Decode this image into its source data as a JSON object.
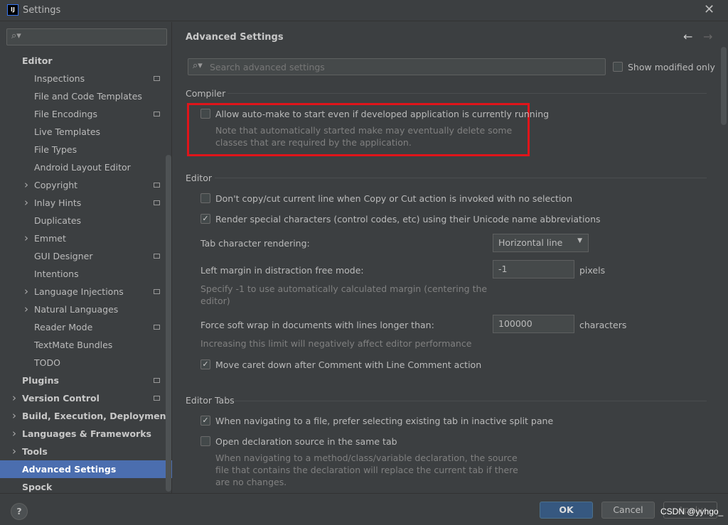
{
  "window": {
    "title": "Settings",
    "app_icon": "IJ"
  },
  "sidebar": {
    "search_placeholder": "",
    "items": [
      {
        "label": "Editor",
        "level": 0,
        "bold": true
      },
      {
        "label": "Inspections",
        "level": 1,
        "badge": true
      },
      {
        "label": "File and Code Templates",
        "level": 1
      },
      {
        "label": "File Encodings",
        "level": 1,
        "badge": true
      },
      {
        "label": "Live Templates",
        "level": 1
      },
      {
        "label": "File Types",
        "level": 1
      },
      {
        "label": "Android Layout Editor",
        "level": 1
      },
      {
        "label": "Copyright",
        "level": 1,
        "expandable": true,
        "badge": true
      },
      {
        "label": "Inlay Hints",
        "level": 1,
        "expandable": true,
        "badge": true
      },
      {
        "label": "Duplicates",
        "level": 1
      },
      {
        "label": "Emmet",
        "level": 1,
        "expandable": true
      },
      {
        "label": "GUI Designer",
        "level": 1,
        "badge": true
      },
      {
        "label": "Intentions",
        "level": 1
      },
      {
        "label": "Language Injections",
        "level": 1,
        "expandable": true,
        "badge": true
      },
      {
        "label": "Natural Languages",
        "level": 1,
        "expandable": true
      },
      {
        "label": "Reader Mode",
        "level": 1,
        "badge": true
      },
      {
        "label": "TextMate Bundles",
        "level": 1
      },
      {
        "label": "TODO",
        "level": 1
      },
      {
        "label": "Plugins",
        "level": 0,
        "bold": true,
        "badge": true
      },
      {
        "label": "Version Control",
        "level": 0,
        "bold": true,
        "expandable": true,
        "badge": true
      },
      {
        "label": "Build, Execution, Deployment",
        "level": 0,
        "bold": true,
        "expandable": true
      },
      {
        "label": "Languages & Frameworks",
        "level": 0,
        "bold": true,
        "expandable": true
      },
      {
        "label": "Tools",
        "level": 0,
        "bold": true,
        "expandable": true
      },
      {
        "label": "Advanced Settings",
        "level": 0,
        "bold": true,
        "selected": true
      },
      {
        "label": "Spock",
        "level": 0,
        "bold": true
      }
    ]
  },
  "main": {
    "title": "Advanced Settings",
    "search_placeholder": "Search advanced settings",
    "show_modified_only": {
      "label": "Show modified only",
      "checked": false
    },
    "compiler": {
      "header": "Compiler",
      "auto_make": {
        "label": "Allow auto-make to start even if developed application is currently running",
        "checked": false,
        "hint1": "Note that automatically started make may eventually delete some",
        "hint2": "classes that are required by the application."
      }
    },
    "editor": {
      "header": "Editor",
      "no_copy": {
        "label": "Don't copy/cut current line when Copy or Cut action is invoked with no selection",
        "checked": false
      },
      "render_special": {
        "label": "Render special characters (control codes, etc) using their Unicode name abbreviations",
        "checked": true
      },
      "tab_rendering": {
        "label": "Tab character rendering:",
        "value": "Horizontal line"
      },
      "left_margin": {
        "label": "Left margin in distraction free mode:",
        "value": "-1",
        "unit": "pixels",
        "hint1": "Specify -1 to use automatically calculated margin (centering the",
        "hint2": "editor)"
      },
      "soft_wrap": {
        "label": "Force soft wrap in documents with lines longer than:",
        "value": "100000",
        "unit": "characters",
        "hint": "Increasing this limit will negatively affect editor performance"
      },
      "move_caret": {
        "label": "Move caret down after Comment with Line Comment action",
        "checked": true
      }
    },
    "editor_tabs": {
      "header": "Editor Tabs",
      "prefer_existing": {
        "label": "When navigating to a file, prefer selecting existing tab in inactive split pane",
        "checked": true
      },
      "open_same_tab": {
        "label": "Open declaration source in the same tab",
        "checked": false,
        "hint1": "When navigating to a method/class/variable declaration, the source",
        "hint2": "file that contains the declaration will replace the current tab if there",
        "hint3": "are no changes."
      }
    }
  },
  "footer": {
    "ok": "OK",
    "cancel": "Cancel",
    "apply": "Apply",
    "help": "?"
  },
  "watermark": "CSDN @yyhgo_",
  "colors": {
    "selection": "#4b6eaf",
    "highlight_box": "#e0141a",
    "ok_button": "#365880"
  }
}
